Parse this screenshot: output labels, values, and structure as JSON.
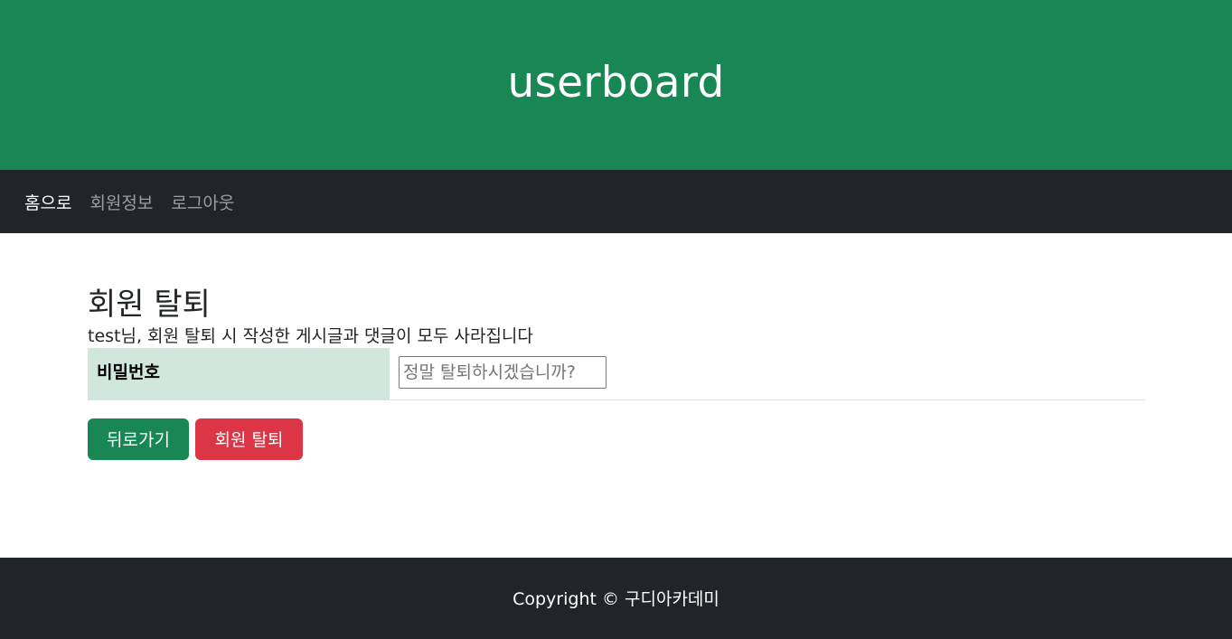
{
  "header": {
    "title": "userboard"
  },
  "nav": {
    "items": [
      {
        "label": "홈으로",
        "active": true
      },
      {
        "label": "회원정보",
        "active": false
      },
      {
        "label": "로그아웃",
        "active": false
      }
    ]
  },
  "main": {
    "title": "회원 탈퇴",
    "notice": "test님, 회원 탈퇴 시 작성한 게시글과 댓글이 모두 사라집니다",
    "form": {
      "password_label": "비밀번호",
      "password_value": "",
      "password_placeholder": "정말 탈퇴하시겠습니까?"
    },
    "buttons": {
      "back_label": "뒤로가기",
      "withdraw_label": "회원 탈퇴"
    }
  },
  "footer": {
    "copyright": "Copyright © 구디아카데미"
  },
  "colors": {
    "header_bg": "#198754",
    "nav_bg": "#212529",
    "label_cell_bg": "#d1e7dd",
    "back_button": "#198754",
    "withdraw_button": "#dc3545",
    "footer_bg": "#212529"
  }
}
